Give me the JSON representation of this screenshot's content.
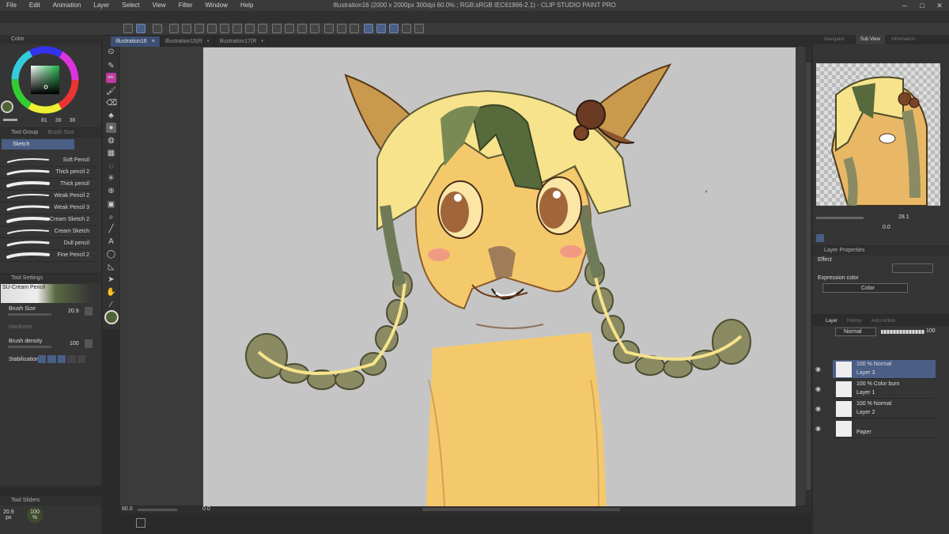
{
  "window": {
    "title": "Illustration16 (2000 x 2000px 300dpi 60.0% ; RGB:sRGB IEC61966-2.1) - CLIP STUDIO PAINT PRO"
  },
  "menu": [
    "File",
    "Edit",
    "Animation",
    "Layer",
    "Select",
    "View",
    "Filter",
    "Window",
    "Help"
  ],
  "tabs": [
    {
      "label": "Illustration16",
      "close": "×",
      "active": true
    },
    {
      "label": "Illustration15(R",
      "close": "•",
      "active": false
    },
    {
      "label": "Illustration17(R",
      "close": "•",
      "active": false
    }
  ],
  "color_panel": {
    "tab_label": "Color",
    "values": [
      "81",
      "38",
      "36"
    ]
  },
  "tool_group": {
    "header": "Tool Group",
    "header2": "Brush Size",
    "selected": "Sketch"
  },
  "brushes": [
    "Soft Pencil",
    "Thick pencil 2",
    "Thick pencil",
    "Weak Pencil 2",
    "Weak Pencil 3",
    "Cream Sketch 2",
    "Cream Sketch",
    "Dull pencil",
    "Fine Pencil 2"
  ],
  "tool_settings": {
    "header": "Tool Settings",
    "preset": "SU-Cream Pencil",
    "brush_size_label": "Brush Size",
    "brush_size_value": "20.9",
    "hardness_label": "Hardness",
    "density_label": "Brush density",
    "density_value": "100",
    "stabilization_label": "Stabilization"
  },
  "tool_sliders": {
    "header": "Tool Sliders",
    "size_value": "20.9",
    "size_unit": "px",
    "density_value": "100",
    "density_unit": "%"
  },
  "right_tabs": [
    "Navigator",
    "Sub View",
    "Information"
  ],
  "navigator": {
    "zoom": "28.1",
    "rotation": "0.0"
  },
  "layer_properties": {
    "header": "Layer Properties",
    "effect_label": "Effect",
    "expression_label": "Expression color",
    "expression_value": "Color"
  },
  "layer_panel": {
    "tabs": [
      "Layer",
      "History",
      "Auto Action"
    ],
    "blend": "Normal",
    "opacity": "100",
    "layers": [
      {
        "mode": "100 % Normal",
        "name": "Layer 3",
        "selected": true
      },
      {
        "mode": "100 % Color burn",
        "name": "Layer 1",
        "selected": false
      },
      {
        "mode": "100 % Normal",
        "name": "Layer 2",
        "selected": false
      },
      {
        "mode": "",
        "name": "Paper",
        "selected": false
      }
    ]
  },
  "status": {
    "zoom": "60.0",
    "angle": "0.0"
  },
  "colors": {
    "accent": "#4a5e86",
    "skin": "#f4c96b",
    "hair_green": "#6f7a58",
    "hair_yellow": "#f6e38b",
    "ear": "#c99a4e",
    "bg_canvas": "#c5c5c5"
  }
}
